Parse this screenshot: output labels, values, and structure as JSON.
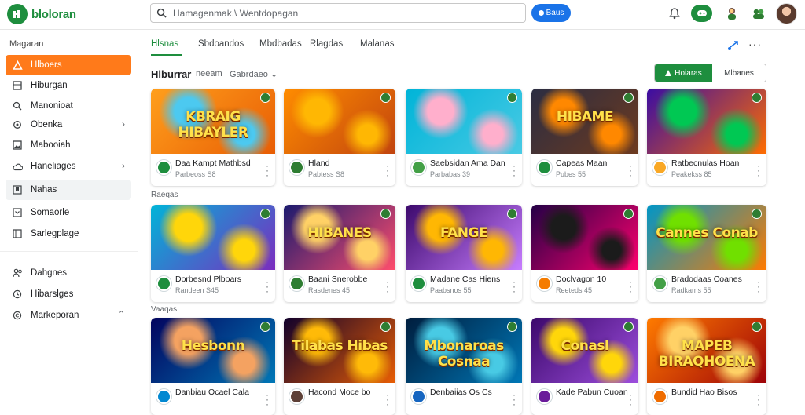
{
  "app": {
    "name": "bloloran"
  },
  "search": {
    "query": "Hamagenmak.\\  Wentdopagan",
    "button_label": "Baus"
  },
  "sidebar": {
    "heading": "Magaran",
    "items": [
      {
        "label": "Hlboers",
        "icon": "home-icon"
      },
      {
        "label": "Hiburgan",
        "icon": "grid-icon"
      },
      {
        "label": "Manonioat",
        "icon": "search-icon"
      },
      {
        "label": "Obenka",
        "icon": "gear-icon"
      },
      {
        "label": "Mabooiah",
        "icon": "image-icon"
      },
      {
        "label": "Haneliages",
        "icon": "cloud-icon"
      },
      {
        "label": "Nahas",
        "icon": "bookmark-icon"
      },
      {
        "label": "Somaorle",
        "icon": "folder-icon"
      },
      {
        "label": "Sarlegplage",
        "icon": "page-icon"
      },
      {
        "label": "Dahgnes",
        "icon": "people-icon"
      },
      {
        "label": "Hibarslges",
        "icon": "clock-icon"
      },
      {
        "label": "Markeporan",
        "icon": "copyright-icon"
      }
    ]
  },
  "tabs": [
    "Hlsnas",
    "Sbdoandos",
    "Mbdbadas",
    "Rlagdas",
    "Malanas"
  ],
  "section": {
    "title": "Hlburrar",
    "subtitle": "neeam",
    "sort": "Gabrdaeo",
    "toggle_on": "Hoiaras",
    "toggle_off": "Mlbanes"
  },
  "row_labels": [
    "Raeqas",
    "Vaaqas"
  ],
  "cards": [
    {
      "art": "KBRAIG HIBAYLER",
      "name": "Daa Kampt Mathbsd",
      "meta": "Parbeoss S8"
    },
    {
      "art": "",
      "name": "Hland",
      "meta": "Pabtess S8"
    },
    {
      "art": "",
      "name": "Saebsidan Ama Dan",
      "meta": "Parbabas 39"
    },
    {
      "art": "HIBAME",
      "name": "Capeas Maan",
      "meta": "Pubes 55"
    },
    {
      "art": "",
      "name": "Ratbecnulas Hoan",
      "meta": "Peakekss 85"
    },
    {
      "art": "",
      "name": "Dorbesnd Plboars",
      "meta": "Randeen S45"
    },
    {
      "art": "HIBANES",
      "name": "Baani Snerobbe",
      "meta": "Rasdenes 45"
    },
    {
      "art": "FANGE",
      "name": "Madane Cas Hiens",
      "meta": "Paabsnos 55"
    },
    {
      "art": "",
      "name": "Doclvagon 10",
      "meta": "Reeteds 45"
    },
    {
      "art": "Cannes Conab",
      "name": "Bradodaas Coanes",
      "meta": "Radkams 55"
    },
    {
      "art": "Hesbonn",
      "name": "Danbiau Ocael Cala",
      "meta": ""
    },
    {
      "art": "Tilabas Hibas",
      "name": "Hacond Moce bo",
      "meta": ""
    },
    {
      "art": "Mbonaroas Cosnaa",
      "name": "Denbaiias Os Cs",
      "meta": ""
    },
    {
      "art": "Conasl",
      "name": "Kade Pabun Cuoan",
      "meta": ""
    },
    {
      "art": "MAPEB BIRAQHOENA",
      "name": "Bundid Hao Bisos",
      "meta": ""
    }
  ],
  "colors": {
    "accent": "#1e8e3e",
    "active_nav": "#ff7a1a",
    "search_button": "#1a73e8"
  }
}
